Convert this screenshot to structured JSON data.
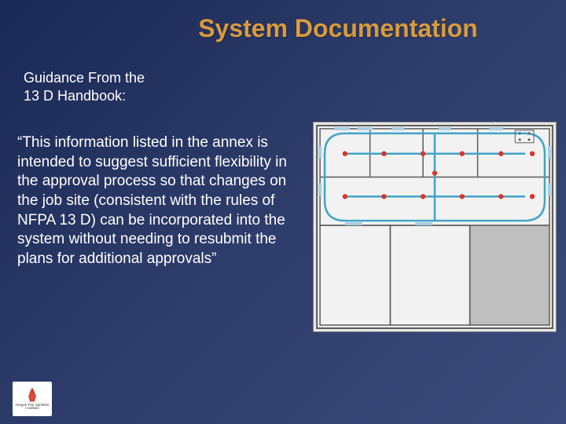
{
  "title": "System Documentation",
  "subtitle": "Guidance From the\n13 D Handbook:",
  "body": "“This information listed in the annex is intended to suggest sufficient flexibility in the approval process so that changes on the job site (consistent with the rules of NFPA 13 D) can be incorporated into the system without needing to resubmit the plans for additional approvals”",
  "logo_text": "Oregon Fire Sprinkler Coalition",
  "floorplan": {
    "sprinkler_color": "#d9332a",
    "pipe_color": "#3fa4c9",
    "wall_color": "#5a5a5a",
    "bg_color": "#f2f2f2",
    "room_fill": "#bfbfbf"
  }
}
